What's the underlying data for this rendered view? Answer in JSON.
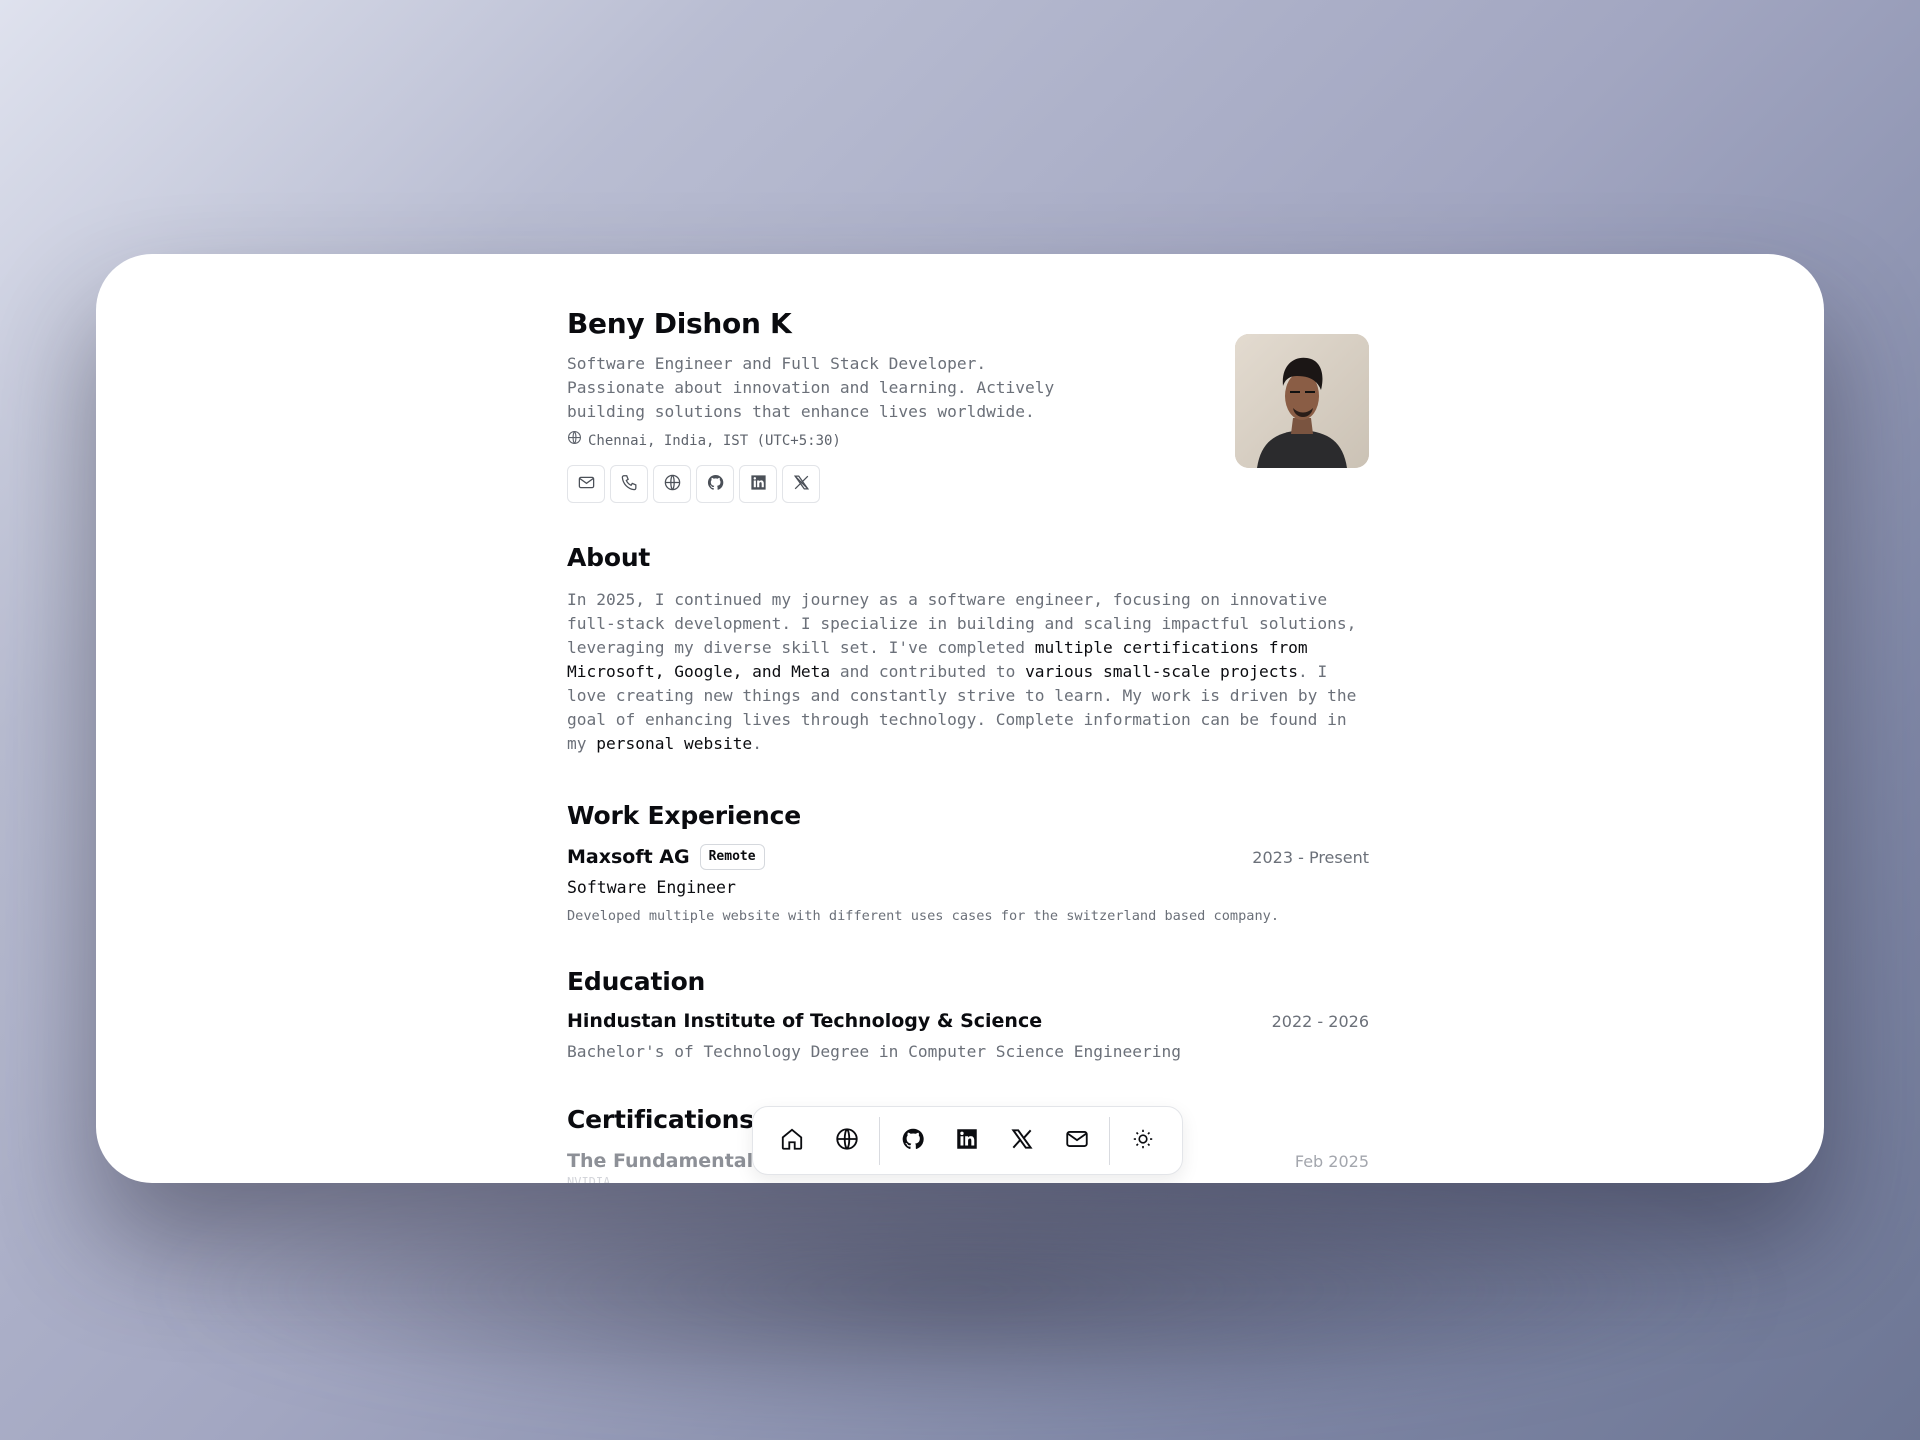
{
  "profile": {
    "name": "Beny Dishon K",
    "tagline": "Software Engineer and Full Stack Developer. Passionate about innovation and learning. Actively building solutions that enhance lives worldwide.",
    "location": "Chennai, India, IST (UTC+5:30)",
    "contact_icons": [
      "mail-icon",
      "phone-icon",
      "globe-icon",
      "github-icon",
      "linkedin-icon",
      "x-icon"
    ]
  },
  "about": {
    "title": "About",
    "p1": "In 2025, I continued my journey as a software engineer, focusing on innovative full-stack development. I specialize in building and scaling impactful solutions, leveraging my diverse skill set. I've completed ",
    "link_certs": "multiple certifications from Microsoft, Google, and Meta",
    "p2": " and contributed to ",
    "link_projects": "various small-scale projects",
    "p3": ". I love creating new things and constantly strive to learn. My work is driven by the goal of enhancing lives through technology. Complete information can be found in my ",
    "link_site": "personal website",
    "p4": "."
  },
  "work": {
    "title": "Work Experience",
    "company": "Maxsoft AG",
    "badge": "Remote",
    "dates": "2023 - Present",
    "role": "Software Engineer",
    "description": "Developed multiple website with different uses cases for the switzerland based company."
  },
  "education": {
    "title": "Education",
    "school": "Hindustan Institute of Technology & Science",
    "dates": "2022 - 2026",
    "degree": "Bachelor's of Technology Degree in Computer Science Engineering"
  },
  "certifications": {
    "title": "Certifications",
    "first_title": "The Fundamentals o",
    "first_date": "Feb 2025",
    "first_issuer": "NVIDIA"
  },
  "dock": {
    "icons": [
      "home-icon",
      "globe-icon",
      "github-icon",
      "linkedin-icon",
      "x-icon",
      "mail-icon",
      "sun-icon"
    ]
  }
}
